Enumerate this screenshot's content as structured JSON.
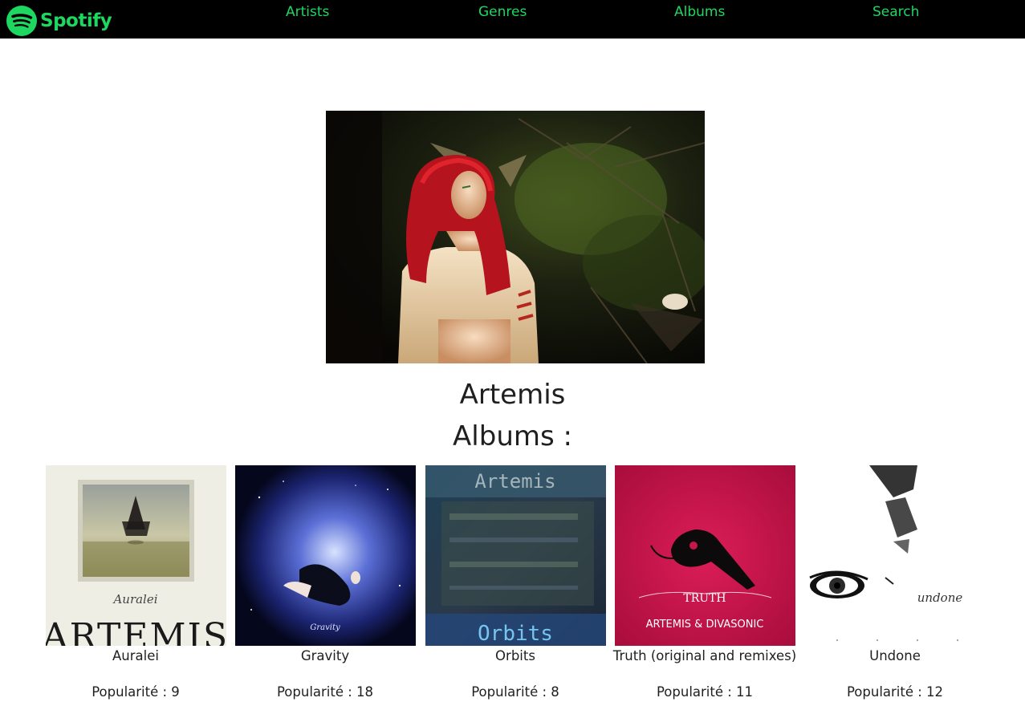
{
  "nav": {
    "brand": "Spotify",
    "links": [
      "Artists",
      "Genres",
      "Albums",
      "Search"
    ],
    "accent_color": "#1ed760",
    "background_color": "#000000"
  },
  "artist": {
    "name": "Artemis",
    "albums_heading": "Albums :"
  },
  "albums": [
    {
      "title": "Auralei",
      "popularity_label": "Popularité : 9",
      "popularity": 9,
      "cover_text": [
        "Auralei",
        "ARTEMIS"
      ]
    },
    {
      "title": "Gravity",
      "popularity_label": "Popularité : 18",
      "popularity": 18,
      "cover_text": [
        "Gravity"
      ]
    },
    {
      "title": "Orbits",
      "popularity_label": "Popularité : 8",
      "popularity": 8,
      "cover_text": [
        "Artemis",
        "Orbits"
      ]
    },
    {
      "title": "Truth (original and remixes)",
      "popularity_label": "Popularité : 11",
      "popularity": 11,
      "cover_text": [
        "TRUTH",
        "ARTEMIS & DIVASONIC"
      ]
    },
    {
      "title": "Undone",
      "popularity_label": "Popularité : 12",
      "popularity": 12,
      "cover_text": [
        "undone"
      ]
    }
  ]
}
